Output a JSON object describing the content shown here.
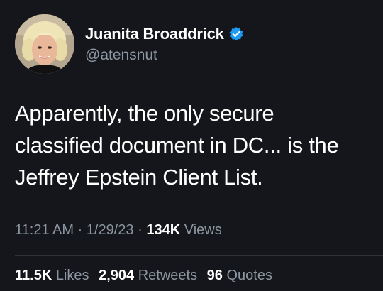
{
  "author": {
    "name": "Juanita Broaddrick",
    "handle": "@atensnut",
    "verified_icon": "verified-badge-icon"
  },
  "tweet": {
    "lines": [
      "Apparently, the only secure",
      "classified document in DC... is the",
      "Jeffrey Epstein Client List."
    ]
  },
  "meta": {
    "time": "11:21 AM",
    "separator": "·",
    "date": "1/29/23",
    "views_count": "134K",
    "views_label": "Views"
  },
  "stats": {
    "likes_count": "11.5K",
    "likes_label": "Likes",
    "retweets_count": "2,904",
    "retweets_label": "Retweets",
    "quotes_count": "96",
    "quotes_label": "Quotes"
  },
  "colors": {
    "background": "#15161b",
    "verified": "#1d9bf0",
    "muted": "#8b96a0",
    "text": "#ffffff"
  }
}
